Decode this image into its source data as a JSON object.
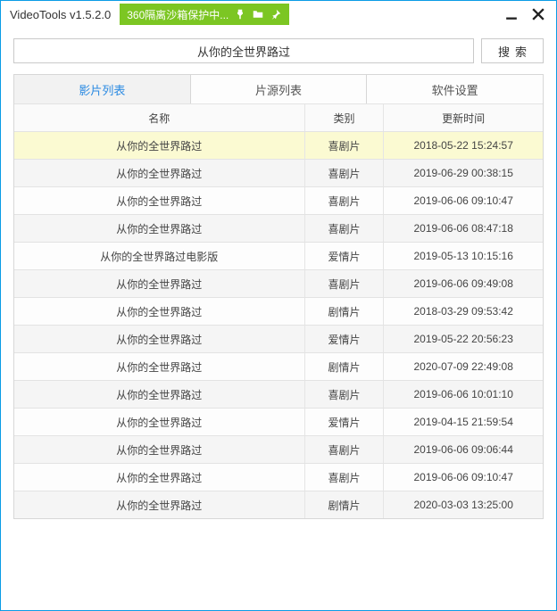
{
  "titlebar": {
    "app_title": "VideoTools v1.5.2.0",
    "sandbox_label": "360隔离沙箱保护中..."
  },
  "search": {
    "value": "从你的全世界路过",
    "button_label": "搜索"
  },
  "tabs": [
    {
      "label": "影片列表",
      "active": true
    },
    {
      "label": "片源列表",
      "active": false
    },
    {
      "label": "软件设置",
      "active": false
    }
  ],
  "table": {
    "columns": {
      "name": "名称",
      "category": "类别",
      "updated": "更新时间"
    },
    "rows": [
      {
        "name": "从你的全世界路过",
        "category": "喜剧片",
        "updated": "2018-05-22 15:24:57",
        "selected": true
      },
      {
        "name": "从你的全世界路过",
        "category": "喜剧片",
        "updated": "2019-06-29 00:38:15"
      },
      {
        "name": "从你的全世界路过",
        "category": "喜剧片",
        "updated": "2019-06-06 09:10:47"
      },
      {
        "name": "从你的全世界路过",
        "category": "喜剧片",
        "updated": "2019-06-06 08:47:18"
      },
      {
        "name": "从你的全世界路过电影版",
        "category": "爱情片",
        "updated": "2019-05-13 10:15:16"
      },
      {
        "name": "从你的全世界路过",
        "category": "喜剧片",
        "updated": "2019-06-06 09:49:08"
      },
      {
        "name": "从你的全世界路过",
        "category": "剧情片",
        "updated": "2018-03-29 09:53:42"
      },
      {
        "name": "从你的全世界路过",
        "category": "爱情片",
        "updated": "2019-05-22 20:56:23"
      },
      {
        "name": "从你的全世界路过",
        "category": "剧情片",
        "updated": "2020-07-09 22:49:08"
      },
      {
        "name": "从你的全世界路过",
        "category": "喜剧片",
        "updated": "2019-06-06 10:01:10"
      },
      {
        "name": "从你的全世界路过",
        "category": "爱情片",
        "updated": "2019-04-15 21:59:54"
      },
      {
        "name": "从你的全世界路过",
        "category": "喜剧片",
        "updated": "2019-06-06 09:06:44"
      },
      {
        "name": "从你的全世界路过",
        "category": "喜剧片",
        "updated": "2019-06-06 09:10:47"
      },
      {
        "name": "从你的全世界路过",
        "category": "剧情片",
        "updated": "2020-03-03 13:25:00"
      }
    ]
  }
}
